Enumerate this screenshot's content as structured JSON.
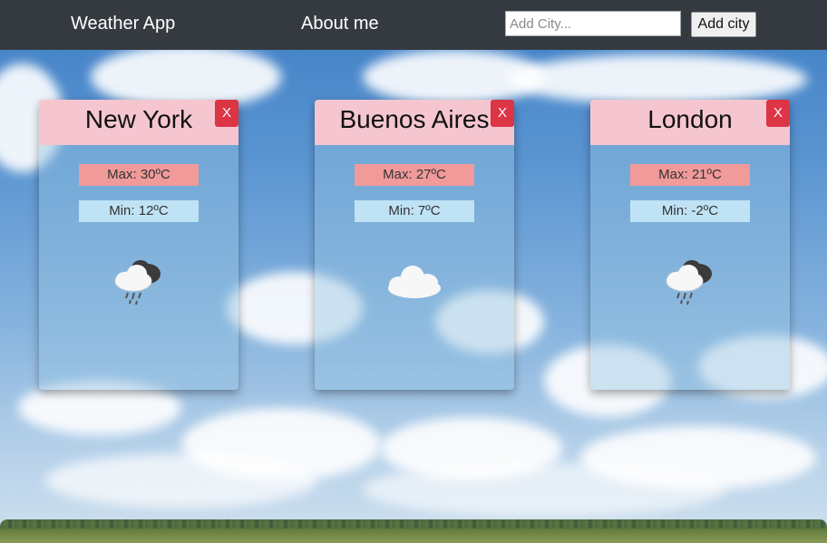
{
  "navbar": {
    "brand": "Weather App",
    "about": "About me",
    "search_placeholder": "Add City...",
    "search_value": "",
    "add_button": "Add city"
  },
  "cards": [
    {
      "city": "New York",
      "close": "X",
      "max": "Max: 30ºC",
      "min": "Min: 12ºC",
      "icon": "rain-cloud-icon"
    },
    {
      "city": "Buenos Aires",
      "close": "X",
      "max": "Max: 27ºC",
      "min": "Min: 7ºC",
      "icon": "cloud-icon"
    },
    {
      "city": "London",
      "close": "X",
      "max": "Max: 21ºC",
      "min": "Min: -2ºC",
      "icon": "rain-cloud-icon"
    }
  ],
  "colors": {
    "navbar": "#343a40",
    "card_header": "#f5c6d0",
    "close_button": "#dc3545",
    "max_badge": "#f19a9a",
    "min_badge": "#bfe3f5"
  }
}
